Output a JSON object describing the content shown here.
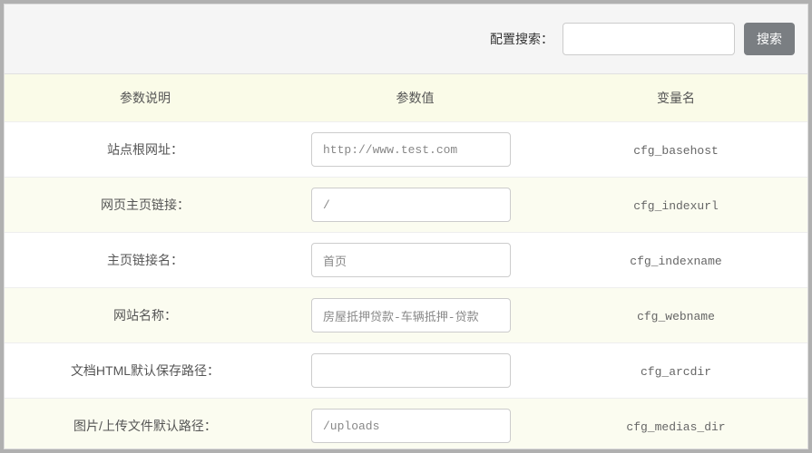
{
  "search": {
    "label": "配置搜索：",
    "placeholder": "",
    "value": "",
    "button": "搜索"
  },
  "table": {
    "headers": {
      "desc": "参数说明",
      "value": "参数值",
      "var": "变量名"
    },
    "rows": [
      {
        "desc": "站点根网址：",
        "value": "http://www.test.com",
        "var": "cfg_basehost"
      },
      {
        "desc": "网页主页链接：",
        "value": "/",
        "var": "cfg_indexurl"
      },
      {
        "desc": "主页链接名：",
        "value": "首页",
        "var": "cfg_indexname"
      },
      {
        "desc": "网站名称：",
        "value": "房屋抵押贷款-车辆抵押-贷款",
        "var": "cfg_webname"
      },
      {
        "desc": "文档HTML默认保存路径：",
        "value": "",
        "var": "cfg_arcdir"
      },
      {
        "desc": "图片/上传文件默认路径：",
        "value": "/uploads",
        "var": "cfg_medias_dir"
      }
    ]
  }
}
